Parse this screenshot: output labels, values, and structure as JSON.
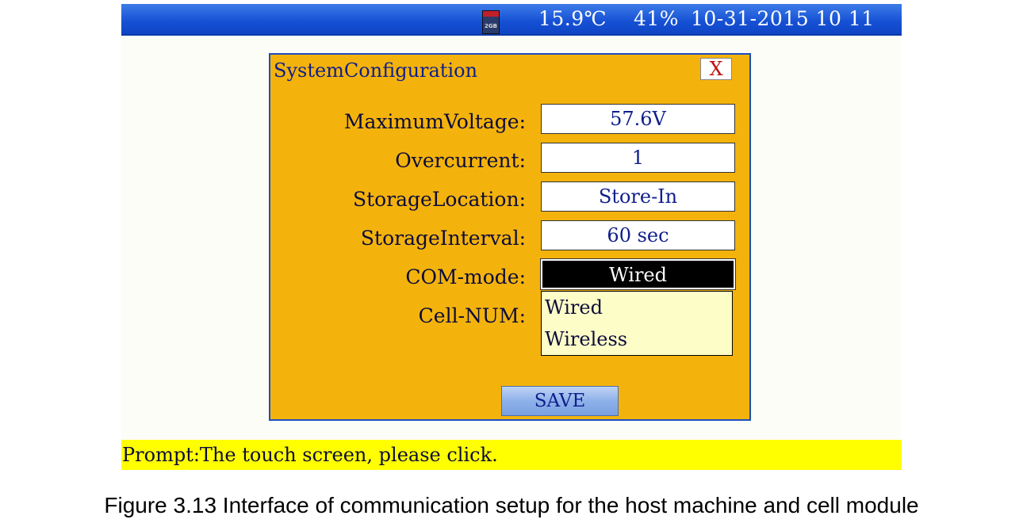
{
  "status_bar": {
    "temperature": "15.9℃",
    "humidity": "41%",
    "datetime": "10-31-2015 10 11",
    "sd_card_label": "2GB"
  },
  "dialog": {
    "title": "SystemConfiguration",
    "close_label": "X",
    "rows": [
      {
        "label": "MaximumVoltage:",
        "value": "57.6V"
      },
      {
        "label": "Overcurrent:",
        "value": "1"
      },
      {
        "label": "StorageLocation:",
        "value": "Store-In"
      },
      {
        "label": "StorageInterval:",
        "value": "60 sec"
      },
      {
        "label": "COM-mode:",
        "value": "Wired"
      },
      {
        "label": "Cell-NUM:",
        "value": ""
      }
    ],
    "dropdown_options": [
      "Wired",
      "Wireless"
    ],
    "save_label": "SAVE"
  },
  "prompt": {
    "text": "Prompt:The touch screen, please click."
  },
  "caption": "Figure 3.13 Interface of communication setup for the host machine and cell module"
}
